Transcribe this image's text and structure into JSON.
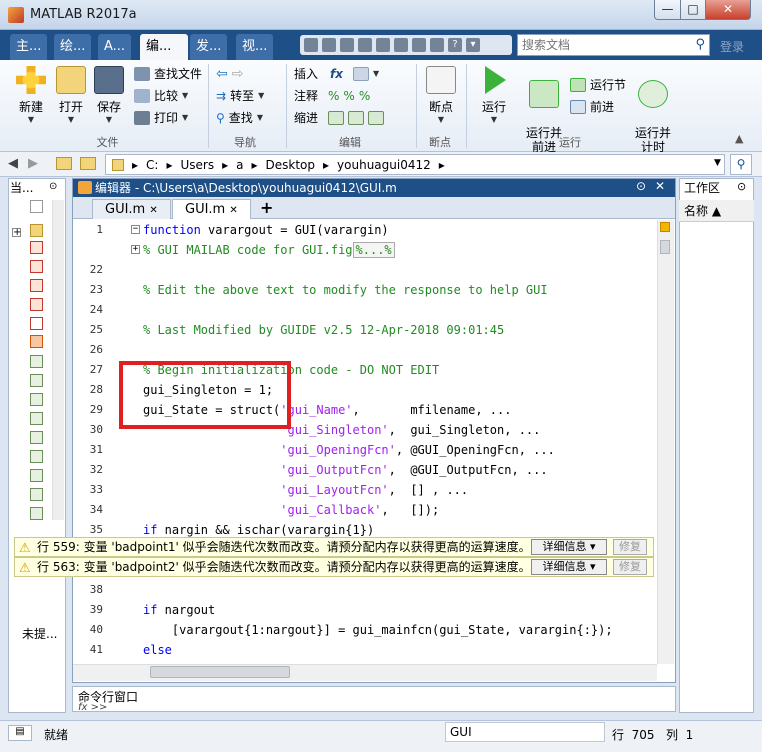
{
  "window": {
    "title": "MATLAB R2017a",
    "min": "—",
    "max": "□",
    "close": "✕"
  },
  "tabs": [
    "主...",
    "绘...",
    "A...",
    "编...",
    "发...",
    "视..."
  ],
  "search": {
    "placeholder": "搜索文档",
    "login": "登录"
  },
  "ribbon": {
    "file": {
      "new": "新建",
      "open": "打开",
      "save": "保存",
      "find_files": "查找文件",
      "compare": "比较",
      "print": "打印",
      "label": "文件"
    },
    "nav": {
      "goto": "转至",
      "find": "查找",
      "label": "导航"
    },
    "edit": {
      "insert": "插入",
      "comment": "注释",
      "indent": "缩进",
      "label": "编辑"
    },
    "breakpoints": {
      "bp": "断点",
      "label": "断点"
    },
    "run": {
      "run": "运行",
      "run_advance": "运行并\n前进",
      "run_section": "运行节",
      "advance": "前进",
      "run_time": "运行并\n计时",
      "label": "运行"
    }
  },
  "path": [
    "C:",
    "Users",
    "a",
    "Desktop",
    "youhuagui0412"
  ],
  "left_panel": {
    "title": "当...",
    "bottom": "未提..."
  },
  "editor": {
    "title": "编辑器 - C:\\Users\\a\\Desktop\\youhuagui0412\\GUI.m",
    "tabs": [
      "GUI.m",
      "GUI.m"
    ],
    "add_tab": "+",
    "lines": [
      {
        "n": "1",
        "text": "function varargout = GUI(varargin)"
      },
      {
        "n": "",
        "text": "% GUI MAILAB code for GUI.fig"
      },
      {
        "n": "22",
        "text": ""
      },
      {
        "n": "23",
        "text": "% Edit the above text to modify the response to help GUI"
      },
      {
        "n": "24",
        "text": ""
      },
      {
        "n": "25",
        "text": "% Last Modified by GUIDE v2.5 12-Apr-2018 09:01:45"
      },
      {
        "n": "26",
        "text": ""
      },
      {
        "n": "27",
        "text": "% Begin initialization code - DO NOT EDIT"
      },
      {
        "n": "28",
        "text": "gui_Singleton = 1;"
      },
      {
        "n": "29",
        "text": "gui_State = struct('gui_Name',       mfilename, ..."
      },
      {
        "n": "30",
        "text": "                   'gui_Singleton',  gui_Singleton, ..."
      },
      {
        "n": "31",
        "text": "                   'gui_OpeningFcn', @GUI_OpeningFcn, ..."
      },
      {
        "n": "32",
        "text": "                   'gui_OutputFcn',  @GUI_OutputFcn, ..."
      },
      {
        "n": "33",
        "text": "                   'gui_LayoutFcn',  [] , ..."
      },
      {
        "n": "34",
        "text": "                   'gui_Callback',   []);"
      },
      {
        "n": "35",
        "text": "if nargin && ischar(varargin{1})"
      },
      {
        "n": "38",
        "text": ""
      },
      {
        "n": "39",
        "text": "if nargout"
      },
      {
        "n": "40",
        "text": "    [varargout{1:nargout}] = gui_mainfcn(gui_State, varargin{:});"
      },
      {
        "n": "41",
        "text": "else"
      }
    ],
    "fold_marker": "%...%"
  },
  "warnings": [
    {
      "text": "行 559: 变量 'badpoint1' 似乎会随迭代次数而改变。请预分配内存以获得更高的运算速度。",
      "detail": "详细信息 ▾",
      "fix": "修复"
    },
    {
      "text": "行 563: 变量 'badpoint2' 似乎会随迭代次数而改变。请预分配内存以获得更高的运算速度。",
      "detail": "详细信息 ▾",
      "fix": "修复"
    }
  ],
  "workspace": {
    "title": "工作区",
    "col": "名称 ▲"
  },
  "cmd": {
    "title": "命令行窗口",
    "prompt": "fx >>"
  },
  "status": {
    "ready": "就绪",
    "file": "GUI",
    "pos": "行  705   列  1"
  }
}
